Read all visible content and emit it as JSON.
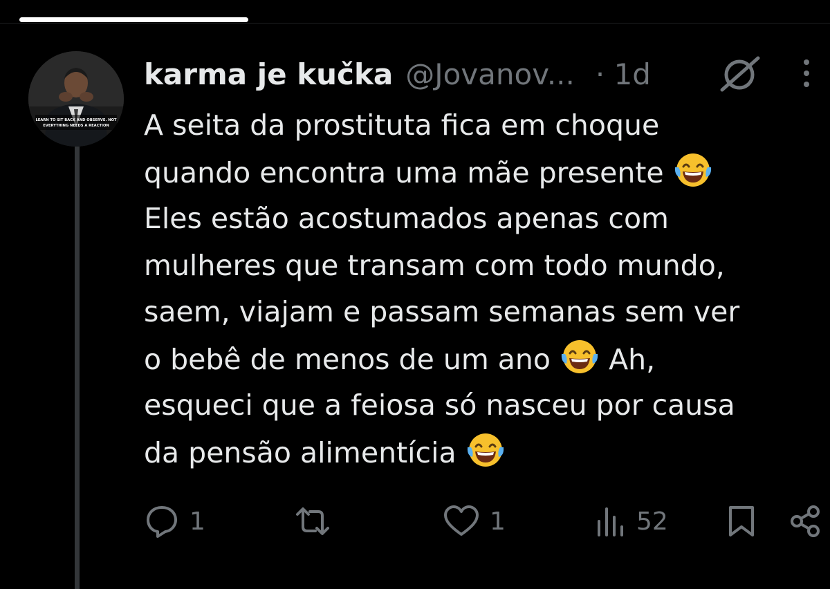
{
  "tweet": {
    "display_name": "karma je kučka",
    "handle": "@Jovanov...",
    "time": "· 1d",
    "lines": [
      {
        "text": "A seita da prostituta fica em choque",
        "emoji": false
      },
      {
        "text": "quando encontra uma mãe presente ",
        "emoji": true
      },
      {
        "text": "Eles estão acostumados apenas com",
        "emoji": false
      },
      {
        "text": "mulheres que transam com todo mundo,",
        "emoji": false
      },
      {
        "text": "saem, viajam e passam semanas sem ver",
        "emoji": false
      },
      {
        "text": "o bebê de menos de um ano ",
        "emoji": true,
        "after": " Ah,"
      },
      {
        "text": "esqueci que a feiosa só nasceu por causa",
        "emoji": false
      },
      {
        "text": "da pensão alimentícia ",
        "emoji": true
      }
    ],
    "emoji_name": "face-with-tears-of-joy",
    "avatar_caption_line1": "LEARN TO SIT BACK AND OBSERVE. NOT",
    "avatar_caption_line2": "EVERYTHING NEEDS A REACTION"
  },
  "actions": {
    "reply": {
      "icon": "reply-icon",
      "count": "1"
    },
    "repost": {
      "icon": "repost-icon",
      "count": ""
    },
    "like": {
      "icon": "heart-icon",
      "count": "1"
    },
    "views": {
      "icon": "views-icon",
      "count": "52"
    },
    "bookmark": {
      "icon": "bookmark-icon"
    },
    "share": {
      "icon": "share-icon"
    }
  },
  "colors": {
    "background": "#000000",
    "text_primary": "#e7e9ea",
    "text_secondary": "#71767b",
    "thread_line": "#333639"
  }
}
